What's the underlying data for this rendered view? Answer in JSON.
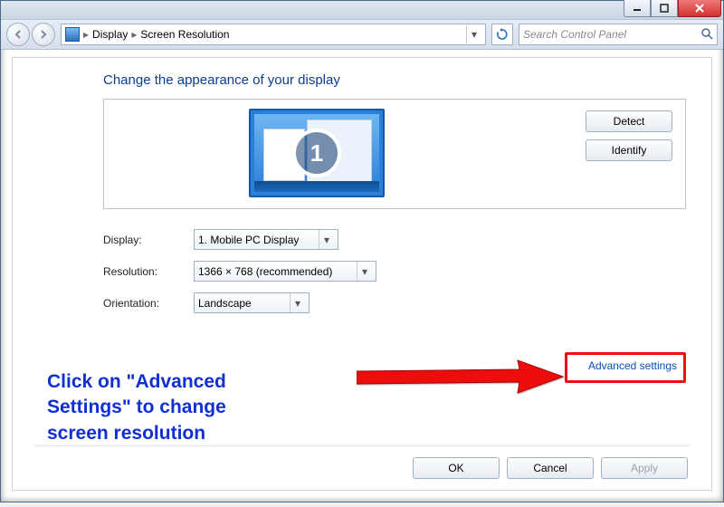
{
  "titlebar": {
    "min_tip": "Minimize",
    "max_tip": "Maximize",
    "close_tip": "Close"
  },
  "nav": {
    "back_tip": "Back",
    "fwd_tip": "Forward",
    "refresh_tip": "Refresh"
  },
  "breadcrumb": {
    "item1": "Display",
    "item2": "Screen Resolution"
  },
  "search": {
    "placeholder": "Search Control Panel"
  },
  "heading": "Change the appearance of your display",
  "preview": {
    "monitor_number": "1",
    "detect_label": "Detect",
    "identify_label": "Identify"
  },
  "form": {
    "display_label": "Display:",
    "display_value": "1. Mobile PC Display",
    "resolution_label": "Resolution:",
    "resolution_value": "1366 × 768 (recommended)",
    "orientation_label": "Orientation:",
    "orientation_value": "Landscape"
  },
  "links": {
    "advanced": "Advanced settings"
  },
  "footer": {
    "ok": "OK",
    "cancel": "Cancel",
    "apply": "Apply"
  },
  "annotation": {
    "text": "Click on \"Advanced\nSettings\" to change\nscreen resolution"
  }
}
